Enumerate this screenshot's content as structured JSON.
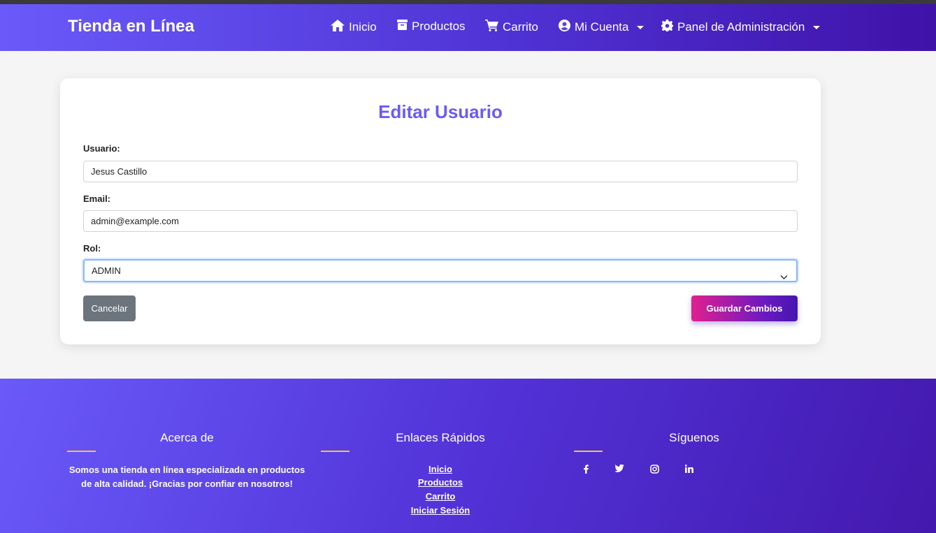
{
  "nav": {
    "brand": "Tienda en Línea",
    "items": [
      {
        "label": "Inicio",
        "icon": "home-icon"
      },
      {
        "label": "Productos",
        "icon": "box-icon"
      },
      {
        "label": "Carrito",
        "icon": "cart-icon"
      },
      {
        "label": "Mi Cuenta",
        "icon": "user-circle-icon",
        "dropdown": true
      },
      {
        "label": "Panel de Administración",
        "icon": "gear-icon",
        "dropdown": true
      }
    ]
  },
  "form": {
    "title": "Editar Usuario",
    "username_label": "Usuario:",
    "username_value": "Jesus Castillo",
    "email_label": "Email:",
    "email_value": "admin@example.com",
    "role_label": "Rol:",
    "role_value": "ADMIN",
    "cancel_label": "Cancelar",
    "save_label": "Guardar Cambios"
  },
  "footer": {
    "about_title": "Acerca de",
    "about_text": "Somos una tienda en línea especializada en productos de alta calidad. ¡Gracias por confiar en nosotros!",
    "links_title": "Enlaces Rápidos",
    "links": [
      "Inicio",
      "Productos",
      "Carrito",
      "Iniciar Sesión"
    ],
    "social_title": "Síguenos",
    "social_icons": [
      "facebook-icon",
      "twitter-icon",
      "instagram-icon",
      "linkedin-icon"
    ]
  },
  "colors": {
    "accent": "#6a5af9",
    "nav_gradient_end": "#3f12a8",
    "save_gradient_start": "#e0208f",
    "cancel": "#6c757d",
    "divider": "#f5c542"
  }
}
